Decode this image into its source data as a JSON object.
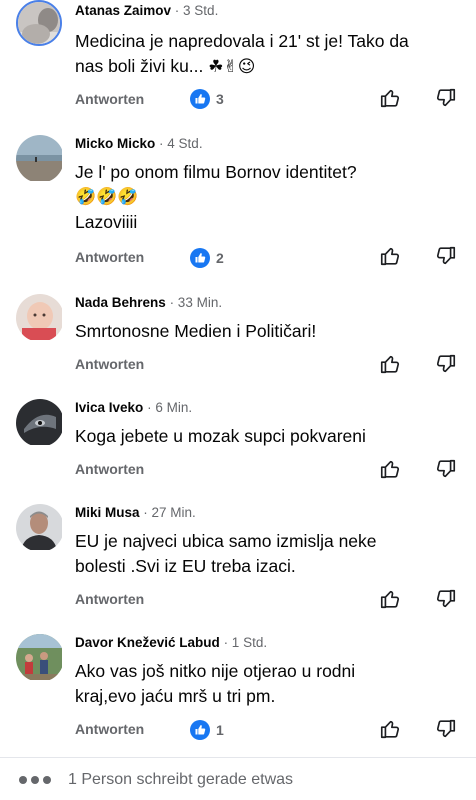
{
  "colors": {
    "accent": "#1877f2",
    "muted": "#65676b",
    "text": "#050505"
  },
  "comments": [
    {
      "name": "Atanas Zaimov",
      "time": "· 3 Std.",
      "text_lines": [
        "Medicina je napredovala i 21' st je! Tako da",
        "nas boli živi ku..."
      ],
      "emoji": "☘✌😉",
      "reply": "Antworten",
      "reaction_count": "3",
      "avatar_icon": "person-silhouette-photo"
    },
    {
      "name": "Micko Micko",
      "time": "· 4 Std.",
      "text_lines": [
        "Je l' po onom filmu Bornov identitet?"
      ],
      "emoji": "🤣🤣🤣",
      "text_after": "Lazoviiii",
      "reply": "Antworten",
      "reaction_count": "2",
      "avatar_icon": "beach-landscape-photo"
    },
    {
      "name": "Nada Behrens",
      "time": "· 33 Min.",
      "text_lines": [
        "Smrtonosne Medien i Političari!"
      ],
      "reply": "Antworten",
      "reaction_count": "",
      "avatar_icon": "baby-photo"
    },
    {
      "name": "Ivica Iveko",
      "time": "· 6 Min.",
      "text_lines": [
        "Koga jebete u mozak supci pokvareni"
      ],
      "reply": "Antworten",
      "reaction_count": "",
      "avatar_icon": "dark-face-photo"
    },
    {
      "name": "Miki Musa",
      "time": "· 27 Min.",
      "text_lines": [
        "EU je najveci ubica samo izmislja neke",
        "bolesti .Svi iz EU treba izaci."
      ],
      "reply": "Antworten",
      "reaction_count": "",
      "avatar_icon": "man-portrait-photo"
    },
    {
      "name": "Davor Knežević Labud",
      "time": "· 1 Std.",
      "text_lines": [
        "Ako vas još nitko nije otjerao u rodni",
        "kraj,evo jaću mrš u tri pm."
      ],
      "reply": "Antworten",
      "reaction_count": "1",
      "avatar_icon": "group-outdoor-photo"
    }
  ],
  "typing": {
    "text": "1 Person schreibt gerade etwas"
  }
}
